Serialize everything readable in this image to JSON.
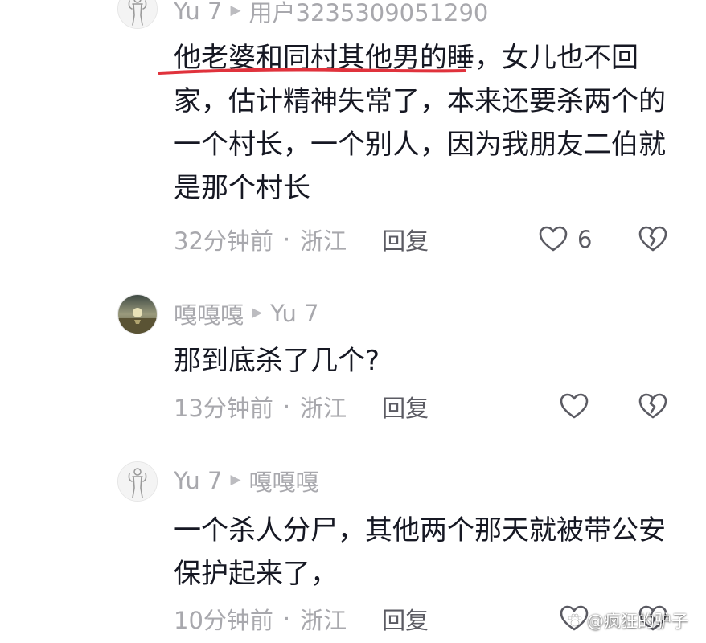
{
  "comments": [
    {
      "username": "Yu 7",
      "reply_to": "用户3235309051290",
      "text": "他老婆和同村其他男的睡，女儿也不回家，估计精神失常了，本来还要杀两个的一个村长，一个别人，因为我朋友二伯就是那个村长",
      "time": "32分钟前",
      "location": "浙江",
      "reply_label": "回复",
      "like_count": "6",
      "avatar_icon": "bodybuilder-avatar-icon"
    },
    {
      "username": "嘎嘎嘎",
      "reply_to": "Yu 7",
      "text": "那到底杀了几个?",
      "time": "13分钟前",
      "location": "浙江",
      "reply_label": "回复",
      "like_count": "",
      "avatar_icon": "sunset-avatar-icon"
    },
    {
      "username": "Yu 7",
      "reply_to": "嘎嘎嘎",
      "text": "一个杀人分尸，其他两个那天就被带公安保护起来了，",
      "time": "10分钟前",
      "location": "浙江",
      "reply_label": "回复",
      "like_count": "",
      "avatar_icon": "bodybuilder-avatar-icon"
    }
  ],
  "separator_dot": "·",
  "reply_arrow": "▶",
  "watermark": "@疯狂的驴子",
  "colors": {
    "primary_text": "#161823",
    "secondary_text": "#a8a8ad",
    "underline": "#e0323c"
  }
}
